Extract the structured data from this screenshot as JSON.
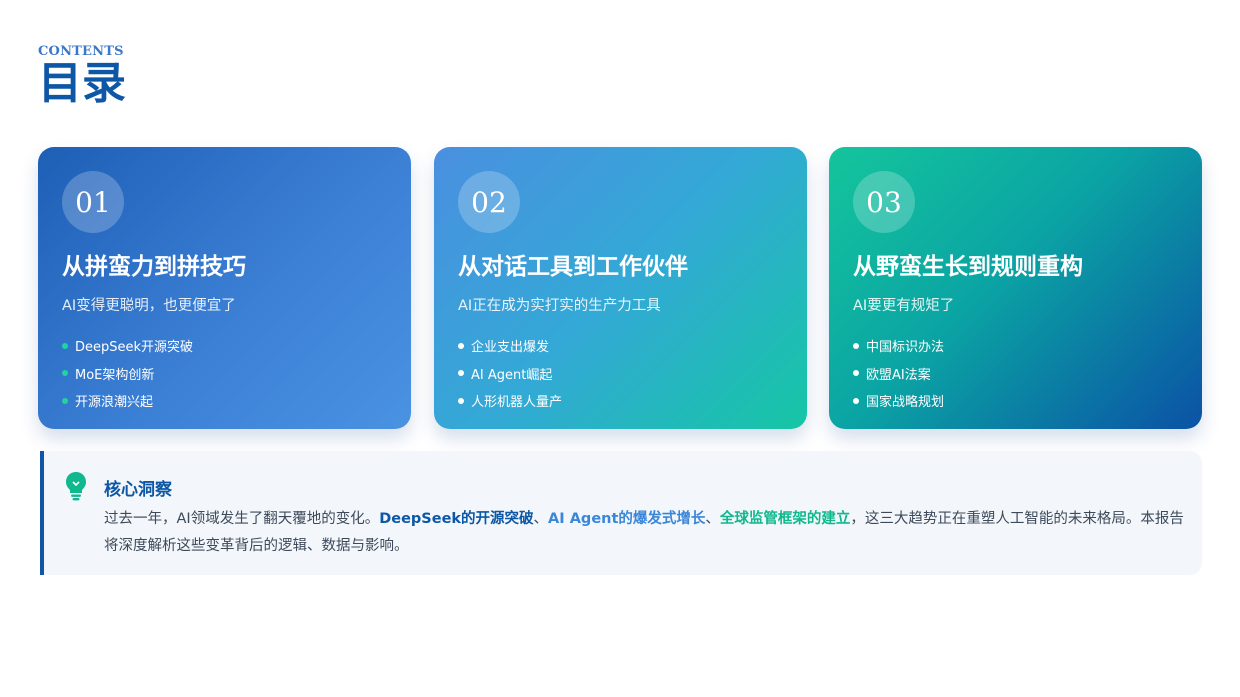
{
  "header": {
    "subtitle": "CONTENTS",
    "title": "目录"
  },
  "cards": [
    {
      "number": "01",
      "title": "从拼蛮力到拼技巧",
      "subtitle": "AI变得更聪明，也更便宜了",
      "items": [
        "DeepSeek开源突破",
        "MoE架构创新",
        "开源浪潮兴起"
      ]
    },
    {
      "number": "02",
      "title": "从对话工具到工作伙伴",
      "subtitle": "AI正在成为实打实的生产力工具",
      "items": [
        "企业支出爆发",
        "AI Agent崛起",
        "人形机器人量产"
      ]
    },
    {
      "number": "03",
      "title": "从野蛮生长到规则重构",
      "subtitle": "AI要更有规矩了",
      "items": [
        "中国标识办法",
        "欧盟AI法案",
        "国家战略规划"
      ]
    }
  ],
  "insight": {
    "icon": "lightbulb-icon",
    "heading": "核心洞察",
    "text_1": "过去一年，AI领域发生了翻天覆地的变化。",
    "highlight_1": "DeepSeek的开源突破",
    "sep_1": "、",
    "highlight_2": "AI Agent的爆发式增长",
    "sep_2": "、",
    "highlight_3": "全球监管框架的建立",
    "text_2": "，这三大趋势正在重塑人工智能的未来格局。本报告将深度解析这些变革背后的逻辑、数据与影响。"
  },
  "colors": {
    "primary": "#0d57a6",
    "accent_blue": "#3a86d8",
    "accent_green": "#10b88d"
  }
}
